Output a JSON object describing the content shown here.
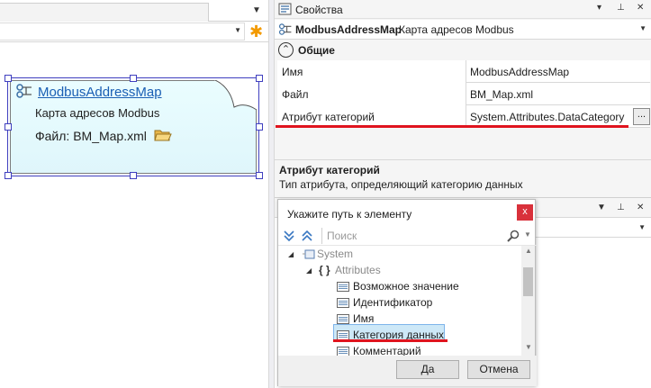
{
  "designer": {
    "shape": {
      "title": "ModbusAddressMap",
      "description": "Карта адресов Modbus",
      "file_label": "Файл: BM_Map.xml"
    }
  },
  "properties": {
    "title": "Свойства",
    "title_buttons": [
      "▾",
      "⊥",
      "✕"
    ],
    "object_name": "ModbusAddressMap",
    "object_desc": "Карта адресов Modbus",
    "category": "Общие",
    "category_toggle": "⌃",
    "rows": [
      {
        "key": "Имя",
        "value": "ModbusAddressMap"
      },
      {
        "key": "Файл",
        "value": "BM_Map.xml"
      },
      {
        "key": "Атрибут категорий",
        "value": "System.Attributes.DataCategory",
        "button": "..."
      }
    ],
    "help": {
      "title": "Атрибут категорий",
      "text": "Тип атрибута, определяющий категорию данных"
    },
    "accent_red": "#e0141e"
  },
  "popup": {
    "title": "Укажите путь к элементу",
    "close": "x",
    "search_placeholder": "Поиск",
    "tree": [
      {
        "label": "System",
        "level": 0,
        "expander": "◢",
        "icon": "namespace-icon"
      },
      {
        "label": "Attributes",
        "level": 1,
        "expander": "◢",
        "icon": "braces-icon",
        "glyph": "{ }"
      },
      {
        "label": "Возможное значение",
        "level": 2,
        "icon": "enum-icon"
      },
      {
        "label": "Идентификатор",
        "level": 2,
        "icon": "enum-icon"
      },
      {
        "label": "Имя",
        "level": 2,
        "icon": "enum-icon"
      },
      {
        "label": "Категория данных",
        "level": 2,
        "icon": "enum-icon",
        "selected": true
      },
      {
        "label": "Комментарий",
        "level": 2,
        "icon": "enum-icon"
      }
    ],
    "ok": "Да",
    "cancel": "Отмена"
  }
}
